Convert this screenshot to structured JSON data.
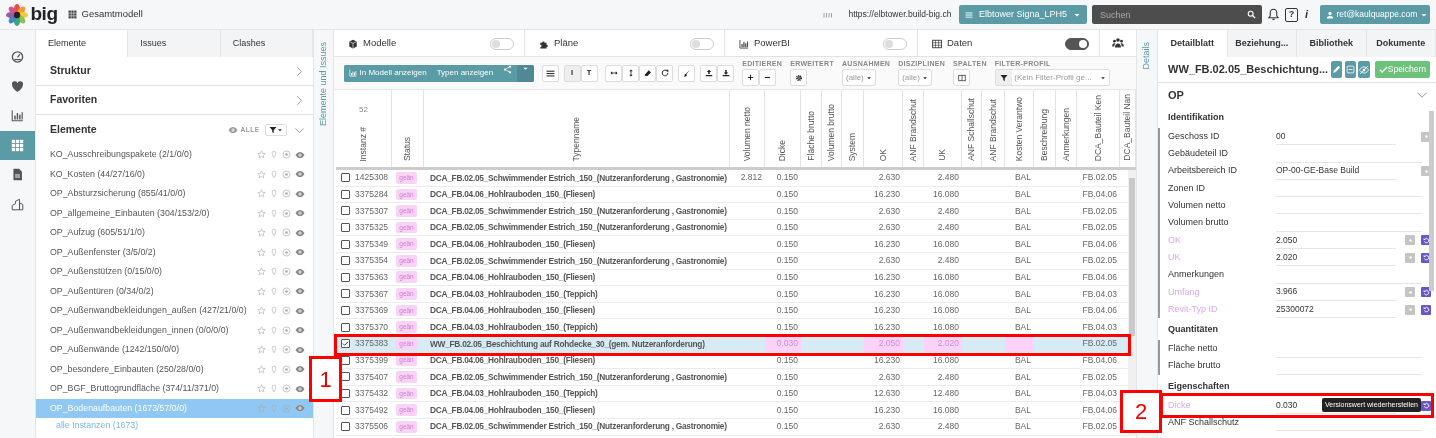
{
  "header": {
    "app": "big",
    "model": "Gesamtmodell",
    "server_url": "https://elbtower.build-big.ch",
    "project": "Elbtower Signa_LPH5",
    "search": {
      "placeholder": "Suchen"
    },
    "help": "?",
    "info": "i",
    "user": "ret@kaulquappe.com"
  },
  "rail": [
    {
      "selected": false
    },
    {
      "selected": false
    },
    {
      "selected": false
    },
    {
      "selected": true
    },
    {
      "selected": false
    },
    {
      "selected": false
    }
  ],
  "left_tabs": [
    {
      "label": "Elemente",
      "selected": true
    },
    {
      "label": "Issues",
      "selected": false
    },
    {
      "label": "Clashes",
      "selected": false
    }
  ],
  "sections": [
    {
      "title": "Struktur",
      "expanded": false
    },
    {
      "title": "Favoriten",
      "expanded": false
    }
  ],
  "elements": {
    "title": "Elemente",
    "filter_label": "ALLE",
    "expanded": true,
    "items": [
      {
        "label": "KO_Ausschreibungspakete (2/1/0/0)",
        "selected": false
      },
      {
        "label": "KO_Kosten (44/27/16/0)",
        "selected": false
      },
      {
        "label": "OP_Absturzsicherung (855/41/0/0)",
        "selected": false
      },
      {
        "label": "OP_allgemeine_Einbauten (304/153/2/0)",
        "selected": false
      },
      {
        "label": "OP_Aufzug (605/51/1/0)",
        "selected": false
      },
      {
        "label": "OP_Außenfenster (3/5/0/2)",
        "selected": false
      },
      {
        "label": "OP_Außenstützen (0/15/0/0)",
        "selected": false
      },
      {
        "label": "OP_Außentüren (0/34/0/2)",
        "selected": false
      },
      {
        "label": "OP_Außenwandbekleidungen_außen (427/21/0/0)",
        "selected": false
      },
      {
        "label": "OP_Außenwandbekleidungen_innen (0/0/0/0)",
        "selected": false
      },
      {
        "label": "OP_Außenwände (1242/150/0/0)",
        "selected": false
      },
      {
        "label": "OP_besondere_Einbauten (250/28/0/0)",
        "selected": false
      },
      {
        "label": "OP_BGF_Bruttogrundfläche (374/11/371/0)",
        "selected": false
      },
      {
        "label": "OP_Bodenaufbauten (1673/57/0/0)",
        "selected": true,
        "children": [
          {
            "label": "alle Instanzen (1673)"
          }
        ]
      }
    ]
  },
  "left_strip": "Elemente und Issues",
  "views": [
    {
      "label": "Modelle",
      "on": false
    },
    {
      "label": "Pläne",
      "on": false
    },
    {
      "label": "PowerBI",
      "on": false
    },
    {
      "label": "Daten",
      "on": true
    }
  ],
  "toolbar": {
    "primary": "In Modell anzeigen",
    "secondary": "Typen anzeigen",
    "mode": [
      {
        "label": "I",
        "selected": true
      },
      {
        "label": "T",
        "selected": false
      }
    ],
    "groups": [
      {
        "label": "EDITIEREN",
        "kind": "edit"
      },
      {
        "label": "ERWEITERT",
        "kind": "settings"
      },
      {
        "label": "AUSNAHMEN",
        "kind": "select",
        "placeholder": "(alle)"
      },
      {
        "label": "DISZIPLINEN",
        "kind": "select",
        "placeholder": "(alle)"
      },
      {
        "label": "SPALTEN",
        "kind": "columns"
      },
      {
        "label": "FILTER-PROFIL",
        "kind": "filter",
        "placeholder": "(Kein Filter-Profil ge..."
      }
    ]
  },
  "table": {
    "instance_count": "52",
    "columns": [
      "Instanz #",
      "Status",
      "Typenname",
      "Volumen netto",
      "Dicke",
      "Fläche brutto",
      "Volumen brutto",
      "System",
      "OK",
      "ANF Brandschut",
      "UK",
      "ANF Schallschut",
      "ANF Brandschut",
      "Kosten Verantwo",
      "Beschreibung",
      "Anmerkungen",
      "DCA_Bauteil Ken",
      "DCA_Bauteil Nan"
    ],
    "rows": [
      {
        "checked": false,
        "selected": false,
        "cells": [
          "1425308",
          "geän",
          "DCA_FB.02.05_Schwimmender Estrich_150_(Nutzeranforderung , Gastronomie)",
          "2.812",
          "0.150",
          null,
          null,
          null,
          "2.630",
          null,
          "2.480",
          null,
          null,
          "BAL",
          null,
          null,
          "FB.02.05",
          null
        ]
      },
      {
        "checked": false,
        "selected": false,
        "cells": [
          "3375284",
          "geän",
          "DCA_FB.04.06_Hohlrauboden_150_(Fliesen)",
          null,
          "0.150",
          null,
          null,
          null,
          "16.230",
          null,
          "16.080",
          null,
          null,
          "BAL",
          null,
          null,
          "FB.04.06",
          null
        ]
      },
      {
        "checked": false,
        "selected": false,
        "cells": [
          "3375307",
          "geän",
          "DCA_FB.02.05_Schwimmender Estrich_150_(Nutzeranforderung , Gastronomie)",
          null,
          "0.150",
          null,
          null,
          null,
          "2.630",
          null,
          "2.480",
          null,
          null,
          "BAL",
          null,
          null,
          "FB.02.05",
          null
        ]
      },
      {
        "checked": false,
        "selected": false,
        "cells": [
          "3375325",
          "geän",
          "DCA_FB.02.05_Schwimmender Estrich_150_(Nutzeranforderung , Gastronomie)",
          null,
          "0.150",
          null,
          null,
          null,
          "2.630",
          null,
          "2.480",
          null,
          null,
          "BAL",
          null,
          null,
          "FB.02.05",
          null
        ]
      },
      {
        "checked": false,
        "selected": false,
        "cells": [
          "3375349",
          "geän",
          "DCA_FB.04.06_Hohlrauboden_150_(Fliesen)",
          null,
          "0.150",
          null,
          null,
          null,
          "16.230",
          null,
          "16.080",
          null,
          null,
          "BAL",
          null,
          null,
          "FB.04.06",
          null
        ]
      },
      {
        "checked": false,
        "selected": false,
        "cells": [
          "3375354",
          "geän",
          "DCA_FB.02.05_Schwimmender Estrich_150_(Nutzeranforderung , Gastronomie)",
          null,
          "0.150",
          null,
          null,
          null,
          "2.630",
          null,
          "2.480",
          null,
          null,
          "BAL",
          null,
          null,
          "FB.02.05",
          null
        ]
      },
      {
        "checked": false,
        "selected": false,
        "cells": [
          "3375363",
          "geän",
          "DCA_FB.04.06_Hohlrauboden_150_(Fliesen)",
          null,
          "0.150",
          null,
          null,
          null,
          "16.230",
          null,
          "16.080",
          null,
          null,
          "BAL",
          null,
          null,
          "FB.04.06",
          null
        ]
      },
      {
        "checked": false,
        "selected": false,
        "cells": [
          "3375367",
          "geän",
          "DCA_FB.04.03_Hohlrauboden_150_(Teppich)",
          null,
          "0.150",
          null,
          null,
          null,
          "16.230",
          null,
          "16.080",
          null,
          null,
          "BAL",
          null,
          null,
          "FB.04.03",
          null
        ]
      },
      {
        "checked": false,
        "selected": false,
        "cells": [
          "3375369",
          "geän",
          "DCA_FB.04.06_Hohlrauboden_150_(Fliesen)",
          null,
          "0.150",
          null,
          null,
          null,
          "16.230",
          null,
          "16.080",
          null,
          null,
          "BAL",
          null,
          null,
          "FB.04.06",
          null
        ]
      },
      {
        "checked": false,
        "selected": false,
        "cells": [
          "3375370",
          "geän",
          "DCA_FB.04.03_Hohlrauboden_150_(Teppich)",
          null,
          "0.150",
          null,
          null,
          null,
          "16.230",
          null,
          "16.080",
          null,
          null,
          "BAL",
          null,
          null,
          "FB.04.03",
          null
        ]
      },
      {
        "checked": true,
        "selected": true,
        "cells": [
          "3375383",
          "geän",
          "WW_FB.02.05_Beschichtung auf Rohdecke_30_(gem. Nutzeranforderung)",
          null,
          {
            "value": "0.030",
            "changed": true
          },
          null,
          null,
          null,
          {
            "value": "2.050",
            "changed": true
          },
          null,
          {
            "value": "2.020",
            "changed": true
          },
          null,
          null,
          {
            "changed": true
          },
          null,
          null,
          "FB.02.05",
          null
        ]
      },
      {
        "checked": false,
        "selected": false,
        "cells": [
          "3375399",
          "geän",
          "DCA_FB.04.06_Hohlrauboden_150_(Fliesen)",
          null,
          "0.150",
          null,
          null,
          null,
          "16.230",
          null,
          "16.080",
          null,
          null,
          "BAL",
          null,
          null,
          "FB.04.06",
          null
        ]
      },
      {
        "checked": false,
        "selected": false,
        "cells": [
          "3375407",
          "geän",
          "DCA_FB.02.05_Schwimmender Estrich_150_(Nutzeranforderung , Gastronomie)",
          null,
          "0.150",
          null,
          null,
          null,
          "2.630",
          null,
          "2.480",
          null,
          null,
          "BAL",
          null,
          null,
          "FB.02.05",
          null
        ]
      },
      {
        "checked": false,
        "selected": false,
        "cells": [
          "3375432",
          "geän",
          "DCA_FB.04.03_Hohlrauboden_150_(Teppich)",
          null,
          "0.150",
          null,
          null,
          null,
          "12.630",
          null,
          "12.480",
          null,
          null,
          "BAL",
          null,
          null,
          "FB.04.03",
          null
        ]
      },
      {
        "checked": false,
        "selected": false,
        "cells": [
          "3375492",
          "geän",
          "DCA_FB.04.06_Hohlrauboden_150_(Fliesen)",
          null,
          "0.150",
          null,
          null,
          null,
          "16.230",
          null,
          "16.080",
          null,
          null,
          "BAL",
          null,
          null,
          "FB.04.06",
          null
        ]
      },
      {
        "checked": false,
        "selected": false,
        "cells": [
          "3375506",
          "geän",
          "DCA_FB.02.05_Schwimmender Estrich_150_(Nutzeranforderung , Gastronomie)",
          null,
          "0.150",
          null,
          null,
          null,
          "2.630",
          null,
          "2.480",
          null,
          null,
          "BAL",
          null,
          null,
          "FB.02.05",
          null
        ]
      }
    ]
  },
  "right_strip": "Details",
  "detail_tabs": [
    {
      "label": "Detailblatt",
      "selected": true
    },
    {
      "label": "Beziehung...",
      "selected": false
    },
    {
      "label": "Bibliothek",
      "selected": false
    },
    {
      "label": "Dokumente",
      "selected": false
    }
  ],
  "detail": {
    "title": "WW_FB.02.05_Beschichtung...",
    "save": "Speichern",
    "section": "OP",
    "expanded": true,
    "groups": [
      {
        "title": "Identifikation",
        "properties": [
          {
            "label": "Geschoss ID",
            "value": "00",
            "changed": false,
            "has_info": true
          },
          {
            "label": "Gebäudeteil ID",
            "changed": false,
            "has_info": false
          },
          {
            "label": "Arbeitsbereich ID",
            "value": "OP-00-GE-Base Build",
            "changed": false,
            "has_info": true
          },
          {
            "label": "Zonen ID",
            "changed": false,
            "has_info": false
          },
          {
            "label": "Volumen netto",
            "changed": false,
            "has_info": false
          },
          {
            "label": "Volumen brutto",
            "changed": false,
            "has_info": false
          },
          {
            "label": "OK",
            "value": "2.050",
            "changed": true,
            "has_info": true
          },
          {
            "label": "UK",
            "value": "2.020",
            "changed": true,
            "has_info": true
          },
          {
            "label": "Anmerkungen",
            "changed": false,
            "has_info": false
          },
          {
            "label": "Umfang",
            "value": "3.966",
            "changed": true,
            "has_info": true
          },
          {
            "label": "Revit-Typ ID",
            "value": "25300072",
            "changed": true,
            "has_info": true
          }
        ]
      },
      {
        "title": "Quantitäten",
        "properties": [
          {
            "label": "Fläche netto",
            "changed": false,
            "has_info": false
          },
          {
            "label": "Fläche brutto",
            "changed": false,
            "has_info": false
          }
        ]
      },
      {
        "title": "Eigenschaften",
        "properties": [
          {
            "label": "Dicke",
            "value": "0.030",
            "changed": true,
            "has_info": false,
            "tooltip": "Versionswert wiederherstellen"
          },
          {
            "label": "ANF Schallschutz",
            "changed": false,
            "has_info": false
          }
        ]
      }
    ]
  },
  "annotations": [
    {
      "label": "1"
    },
    {
      "label": "2"
    }
  ]
}
